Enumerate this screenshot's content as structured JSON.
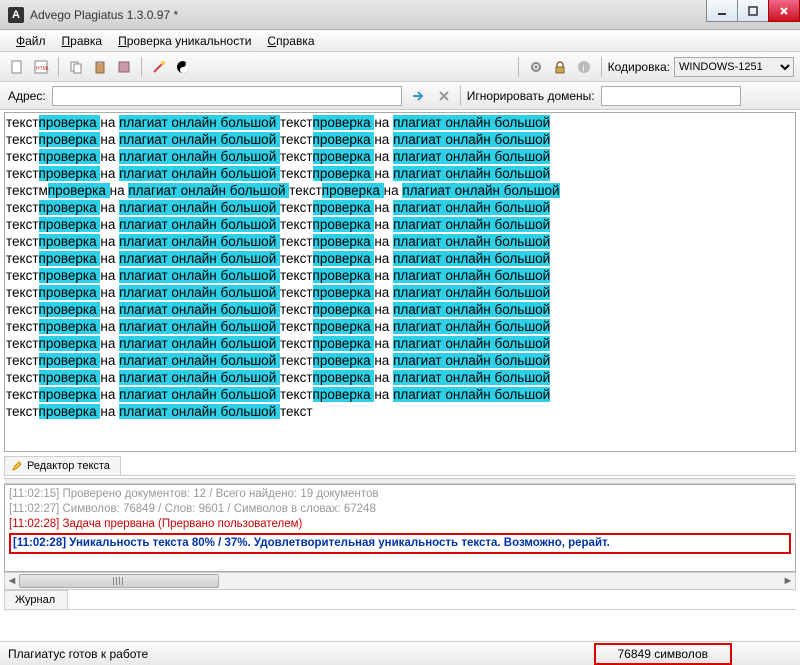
{
  "window": {
    "title": "Advego Plagiatus 1.3.0.97 *"
  },
  "menu": {
    "file": "Файл",
    "edit": "Правка",
    "check": "Проверка уникальности",
    "help": "Справка"
  },
  "toolbar": {
    "encoding_label": "Кодировка:",
    "encoding_value": "WINDOWS-1251"
  },
  "address": {
    "label": "Адрес:",
    "value": "",
    "ignore_label": "Игнорировать домены:",
    "ignore_value": ""
  },
  "text_area": {
    "segments": [
      [
        "текст",
        "проверка "
      ],
      [
        "на ",
        "плагиат "
      ],
      [
        "онлайн "
      ],
      [
        "большой "
      ],
      [
        "текст",
        "проверка "
      ],
      [
        "на ",
        "плагиат "
      ],
      [
        "онлайн "
      ],
      [
        "большой"
      ]
    ],
    "rows_standard": 4,
    "row5": [
      [
        "текстм",
        "проверка "
      ],
      [
        "на ",
        "плагиат "
      ],
      [
        "онлайн "
      ],
      [
        "большой "
      ],
      [
        "текст",
        "проверка "
      ],
      [
        "на ",
        "плагиат "
      ],
      [
        "онлайн "
      ],
      [
        "большой"
      ]
    ],
    "rows_after": 12,
    "last_row": [
      [
        "текст",
        "проверка "
      ],
      [
        "на ",
        "плагиат "
      ],
      [
        "онлайн "
      ],
      [
        "большой "
      ],
      [
        "текст",
        ""
      ]
    ]
  },
  "tabs": {
    "editor": "Редактор текста",
    "journal": "Журнал"
  },
  "log": {
    "l1": "[11:02:15] Проверено документов: 12  / Всего найдено: 19 документов",
    "l2": "[11:02:27] Символов: 76849 / Слов: 9601 / Символов в словах: 67248",
    "l3": "[11:02:28] Задача прервана (Прервано пользователем)",
    "l4": "[11:02:28] Уникальность текста 80% / 37%. Удовлетворительная уникальность текста. Возможно, рерайт."
  },
  "status": {
    "ready": "Плагиатус готов к работе",
    "symbols": "76849 символов"
  }
}
